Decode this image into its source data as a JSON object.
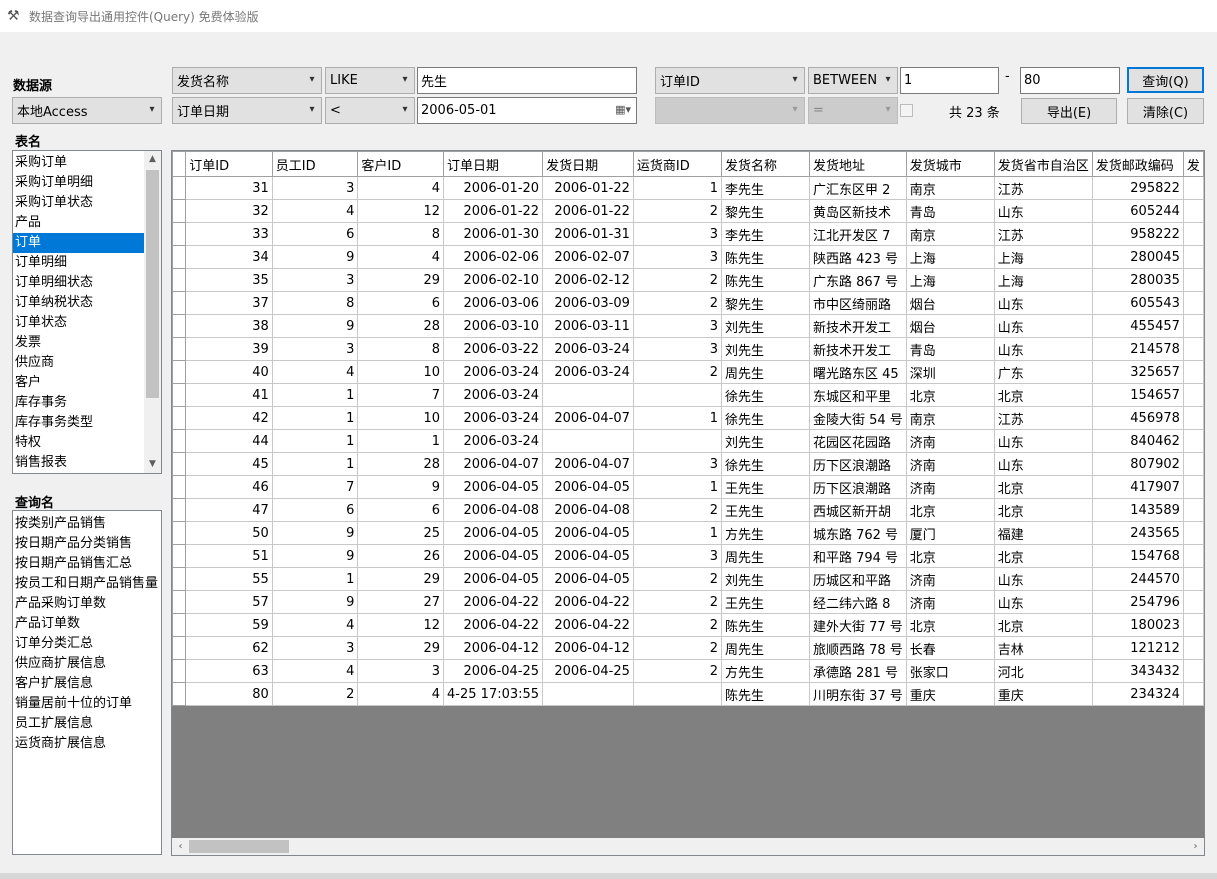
{
  "window": {
    "title": "数据查询导出通用控件(Query) 免费体验版",
    "icon": "tools-icon"
  },
  "datasource": {
    "label": "数据源",
    "value": "本地Access"
  },
  "table_names": {
    "label": "表名",
    "items": [
      "采购订单",
      "采购订单明细",
      "采购订单状态",
      "产品",
      "订单",
      "订单明细",
      "订单明细状态",
      "订单纳税状态",
      "订单状态",
      "发票",
      "供应商",
      "客户",
      "库存事务",
      "库存事务类型",
      "特权",
      "销售报表"
    ],
    "selected": 4
  },
  "query_names": {
    "label": "查询名",
    "items": [
      "按类别产品销售",
      "按日期产品分类销售",
      "按日期产品销售汇总",
      "按员工和日期产品销售量",
      "产品采购订单数",
      "产品订单数",
      "订单分类汇总",
      "供应商扩展信息",
      "客户扩展信息",
      "销量居前十位的订单",
      "员工扩展信息",
      "运货商扩展信息"
    ]
  },
  "filters": {
    "row1": {
      "field": "发货名称",
      "op": "LIKE",
      "value": "先生"
    },
    "row2": {
      "field": "订单日期",
      "op": "<",
      "value": "2006-05-01"
    },
    "row3": {
      "field": "订单ID",
      "op": "BETWEEN",
      "from": "1",
      "dash": "-",
      "to": "80"
    },
    "row4": {
      "field": "",
      "op": "="
    }
  },
  "count_text": "共 23 条",
  "buttons": {
    "query": "查询(Q)",
    "export": "导出(E)",
    "clear": "清除(C)"
  },
  "grid": {
    "columns": [
      "订单ID",
      "员工ID",
      "客户ID",
      "订单日期",
      "发货日期",
      "运货商ID",
      "发货名称",
      "发货地址",
      "发货城市",
      "发货省市自治区",
      "发货邮政编码",
      "发"
    ],
    "rows": [
      [
        "31",
        "3",
        "4",
        "2006-01-20",
        "2006-01-22",
        "1",
        "李先生",
        "广汇东区甲 2",
        "南京",
        "江苏",
        "295822"
      ],
      [
        "32",
        "4",
        "12",
        "2006-01-22",
        "2006-01-22",
        "2",
        "黎先生",
        "黄岛区新技术",
        "青岛",
        "山东",
        "605244"
      ],
      [
        "33",
        "6",
        "8",
        "2006-01-30",
        "2006-01-31",
        "3",
        "李先生",
        "江北开发区 7",
        "南京",
        "江苏",
        "958222"
      ],
      [
        "34",
        "9",
        "4",
        "2006-02-06",
        "2006-02-07",
        "3",
        "陈先生",
        "陕西路 423 号",
        "上海",
        "上海",
        "280045"
      ],
      [
        "35",
        "3",
        "29",
        "2006-02-10",
        "2006-02-12",
        "2",
        "陈先生",
        "广东路 867 号",
        "上海",
        "上海",
        "280035"
      ],
      [
        "37",
        "8",
        "6",
        "2006-03-06",
        "2006-03-09",
        "2",
        "黎先生",
        "市中区绮丽路",
        "烟台",
        "山东",
        "605543"
      ],
      [
        "38",
        "9",
        "28",
        "2006-03-10",
        "2006-03-11",
        "3",
        "刘先生",
        "新技术开发工",
        "烟台",
        "山东",
        "455457"
      ],
      [
        "39",
        "3",
        "8",
        "2006-03-22",
        "2006-03-24",
        "3",
        "刘先生",
        "新技术开发工",
        "青岛",
        "山东",
        "214578"
      ],
      [
        "40",
        "4",
        "10",
        "2006-03-24",
        "2006-03-24",
        "2",
        "周先生",
        "曙光路东区 45",
        "深圳",
        "广东",
        "325657"
      ],
      [
        "41",
        "1",
        "7",
        "2006-03-24",
        "",
        "",
        "徐先生",
        "东城区和平里",
        "北京",
        "北京",
        "154657"
      ],
      [
        "42",
        "1",
        "10",
        "2006-03-24",
        "2006-04-07",
        "1",
        "徐先生",
        "金陵大街 54 号",
        "南京",
        "江苏",
        "456978"
      ],
      [
        "44",
        "1",
        "1",
        "2006-03-24",
        "",
        "",
        "刘先生",
        "花园区花园路",
        "济南",
        "山东",
        "840462"
      ],
      [
        "45",
        "1",
        "28",
        "2006-04-07",
        "2006-04-07",
        "3",
        "徐先生",
        "历下区浪潮路",
        "济南",
        "山东",
        "807902"
      ],
      [
        "46",
        "7",
        "9",
        "2006-04-05",
        "2006-04-05",
        "1",
        "王先生",
        "历下区浪潮路",
        "济南",
        "北京",
        "417907"
      ],
      [
        "47",
        "6",
        "6",
        "2006-04-08",
        "2006-04-08",
        "2",
        "王先生",
        "西城区新开胡",
        "北京",
        "北京",
        "143589"
      ],
      [
        "50",
        "9",
        "25",
        "2006-04-05",
        "2006-04-05",
        "1",
        "方先生",
        "城东路 762 号",
        "厦门",
        "福建",
        "243565"
      ],
      [
        "51",
        "9",
        "26",
        "2006-04-05",
        "2006-04-05",
        "3",
        "周先生",
        "和平路 794 号",
        "北京",
        "北京",
        "154768"
      ],
      [
        "55",
        "1",
        "29",
        "2006-04-05",
        "2006-04-05",
        "2",
        "刘先生",
        "历城区和平路",
        "济南",
        "山东",
        "244570"
      ],
      [
        "57",
        "9",
        "27",
        "2006-04-22",
        "2006-04-22",
        "2",
        "王先生",
        "经二纬六路 8",
        "济南",
        "山东",
        "254796"
      ],
      [
        "59",
        "4",
        "12",
        "2006-04-22",
        "2006-04-22",
        "2",
        "陈先生",
        "建外大街 77 号",
        "北京",
        "北京",
        "180023"
      ],
      [
        "62",
        "3",
        "29",
        "2006-04-12",
        "2006-04-12",
        "2",
        "周先生",
        "旅顺西路 78 号",
        "长春",
        "吉林",
        "121212"
      ],
      [
        "63",
        "4",
        "3",
        "2006-04-25",
        "2006-04-25",
        "2",
        "方先生",
        "承德路 281 号",
        "张家口",
        "河北",
        "343432"
      ],
      [
        "80",
        "2",
        "4",
        "4-25 17:03:55",
        "",
        "",
        "陈先生",
        "川明东街 37 号",
        "重庆",
        "重庆",
        "234324"
      ]
    ]
  }
}
